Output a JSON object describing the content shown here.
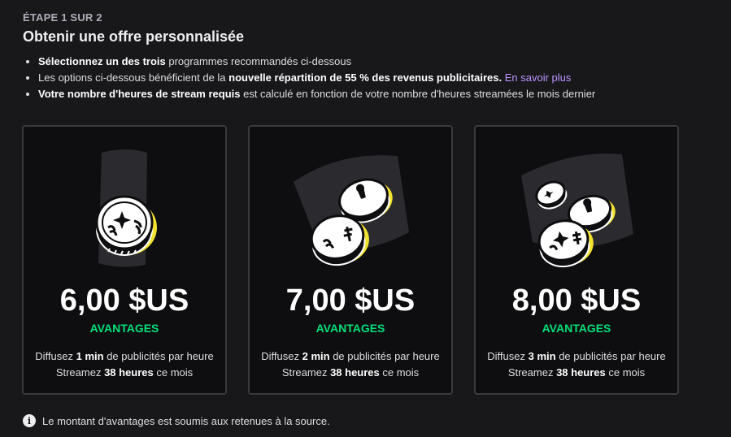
{
  "header": {
    "step": "ÉTAPE 1 SUR 2",
    "title": "Obtenir une offre personnalisée"
  },
  "bullets": [
    {
      "strong": "Sélectionnez un des trois",
      "text": " programmes recommandés ci-dessous"
    },
    {
      "pre": "Les options ci-dessous bénéficient de la ",
      "strong": "nouvelle répartition de 55 % des revenus publicitaires.",
      "link": "En savoir plus"
    },
    {
      "strong": "Votre nombre d'heures de stream requis",
      "text": " est calculé en fonction de votre nombre d'heures streamées le mois dernier"
    }
  ],
  "cards": [
    {
      "price": "6,00 $US",
      "perk": "AVANTAGES",
      "line1_pre": "Diffusez ",
      "line1_bold": "1 min",
      "line1_post": " de publicités par heure",
      "line2_pre": "Streamez ",
      "line2_bold": "38 heures",
      "line2_post": " ce mois"
    },
    {
      "price": "7,00 $US",
      "perk": "AVANTAGES",
      "line1_pre": "Diffusez ",
      "line1_bold": "2 min",
      "line1_post": " de publicités par heure",
      "line2_pre": "Streamez ",
      "line2_bold": "38 heures",
      "line2_post": " ce mois"
    },
    {
      "price": "8,00 $US",
      "perk": "AVANTAGES",
      "line1_pre": "Diffusez ",
      "line1_bold": "3 min",
      "line1_post": " de publicités par heure",
      "line2_pre": "Streamez ",
      "line2_bold": "38 heures",
      "line2_post": " ce mois"
    }
  ],
  "footer": {
    "icon": "info-icon",
    "text": "Le montant d'avantages est soumis aux retenues à la source."
  },
  "colors": {
    "accent_link": "#bf94ff",
    "perk_green": "#00e07a",
    "coin_yellow": "#f2e230"
  }
}
